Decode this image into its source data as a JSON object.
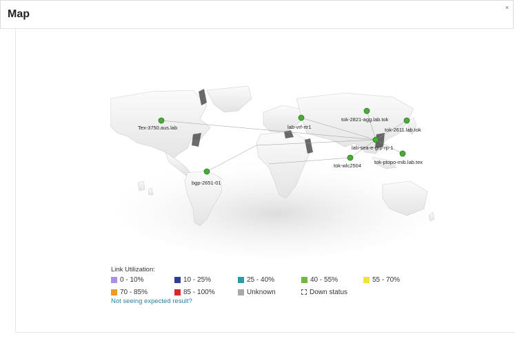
{
  "header": {
    "title": "Map",
    "close_glyph": "×"
  },
  "map": {
    "nodes": [
      {
        "label": "Tex-3750.aus.lab"
      },
      {
        "label": "bgp-2651-01"
      },
      {
        "label": "lab-vrf-rtr1"
      },
      {
        "label": "tok-2821-agg.lab.tok"
      },
      {
        "label": "tok-2611.lab.tok"
      },
      {
        "label": "lab-sea-e-grp-rp-1"
      },
      {
        "label": "tok-wlc2504"
      },
      {
        "label": "tok-ptopo-mib.lab.tex"
      }
    ]
  },
  "legend": {
    "title": "Link Utilization:",
    "items": [
      {
        "label": "0 - 10%",
        "color": "#a98fe6"
      },
      {
        "label": "10 - 25%",
        "color": "#2a3f9a"
      },
      {
        "label": "25 - 40%",
        "color": "#2f9aa6"
      },
      {
        "label": "40 - 55%",
        "color": "#72b83c"
      },
      {
        "label": "55 - 70%",
        "color": "#f2e33a"
      },
      {
        "label": "70 - 85%",
        "color": "#ee9a25"
      },
      {
        "label": "85 - 100%",
        "color": "#d42a2a"
      },
      {
        "label": "Unknown",
        "color": "#a8a8a8"
      },
      {
        "label": "Down status",
        "color": ""
      }
    ],
    "help_link": "Not seeing expected result?"
  }
}
